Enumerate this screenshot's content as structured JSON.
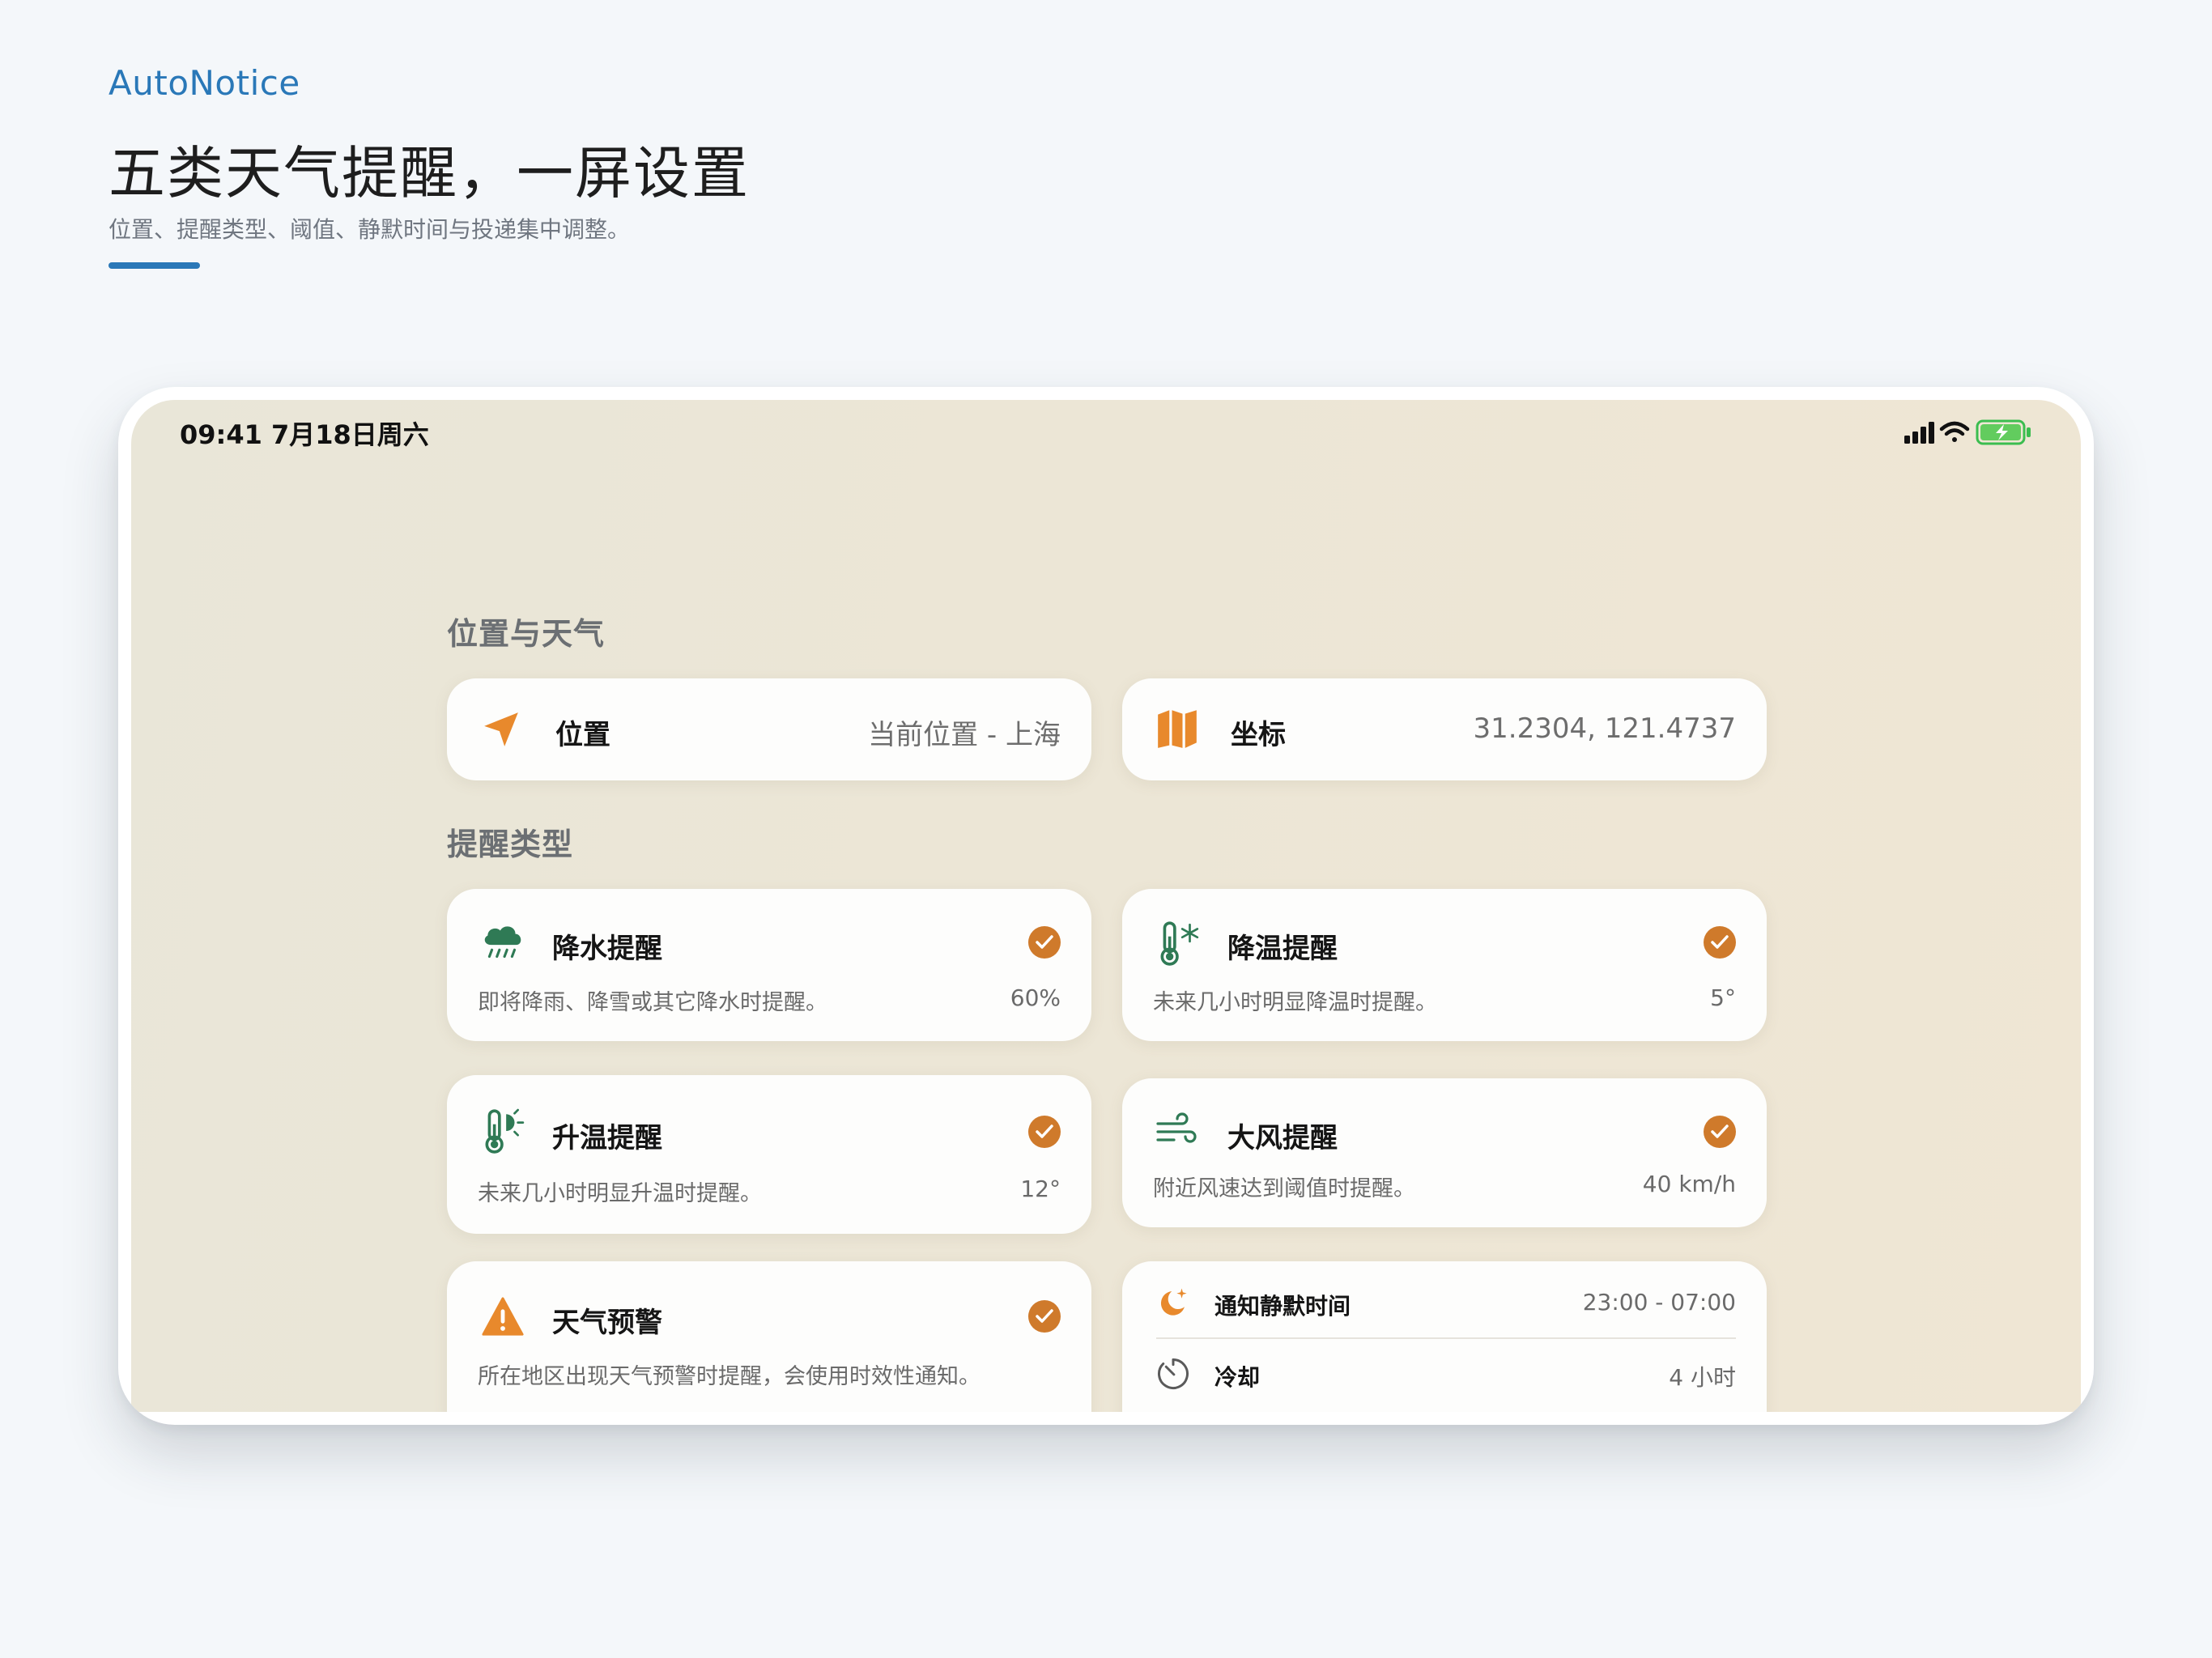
{
  "header": {
    "brand": "AutoNotice",
    "headline": "五类天气提醒，一屏设置",
    "subline": "位置、提醒类型、阈值、静默时间与投递集中调整。"
  },
  "status_bar": {
    "time": "09:41  7月18日周六",
    "icons": [
      "signal-icon",
      "wifi-icon",
      "battery-charging-icon"
    ]
  },
  "sections": {
    "location": "位置与天气",
    "types": "提醒类型"
  },
  "location_rows": [
    {
      "icon": "location-arrow-icon",
      "label": "位置",
      "value": "当前位置 - 上海"
    },
    {
      "icon": "map-icon",
      "label": "坐标",
      "value": "31.2304, 121.4737"
    }
  ],
  "alerts": [
    {
      "icon": "rain-cloud-icon",
      "title": "降水提醒",
      "desc": "即将降雨、降雪或其它降水时提醒。",
      "threshold": "60%",
      "enabled": true
    },
    {
      "icon": "thermometer-snow-icon",
      "title": "降温提醒",
      "desc": "未来几小时明显降温时提醒。",
      "threshold": "5°",
      "enabled": true
    },
    {
      "icon": "thermometer-sun-icon",
      "title": "升温提醒",
      "desc": "未来几小时明显升温时提醒。",
      "threshold": "12°",
      "enabled": true
    },
    {
      "icon": "wind-icon",
      "title": "大风提醒",
      "desc": "附近风速达到阈值时提醒。",
      "threshold": "40 km/h",
      "enabled": true
    },
    {
      "icon": "warning-triangle-icon",
      "title": "天气预警",
      "desc": "所在地区出现天气预警时提醒，会使用时效性通知。",
      "enabled": true
    }
  ],
  "quiet": {
    "quiet_label": "通知静默时间",
    "quiet_value": "23:00 - 07:00",
    "cooldown_label": "冷却",
    "cooldown_value": "4 小时"
  },
  "colors": {
    "accent_blue": "#2a78b8",
    "orange": "#e8892c",
    "check_orange": "#cf7a2b",
    "green": "#2f7a55"
  }
}
